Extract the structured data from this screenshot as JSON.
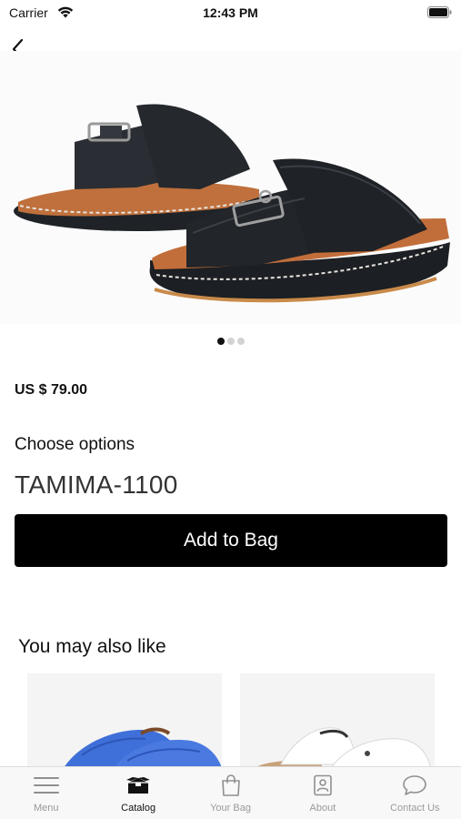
{
  "status_bar": {
    "carrier": "Carrier",
    "time": "12:43 PM"
  },
  "product": {
    "price": "US $ 79.00",
    "options_label": "Choose options",
    "option_value": "TAMIMA-1100",
    "add_button_label": "Add to Bag",
    "image_count": 3,
    "active_image": 1
  },
  "recommendations": {
    "title": "You may also like",
    "items": [
      {
        "image": "blue-sandal",
        "accent": "#3f6fd8"
      },
      {
        "image": "white-sandal",
        "accent": "#ffffff"
      }
    ]
  },
  "tab_bar": {
    "items": [
      {
        "label": "Menu",
        "icon": "menu-icon",
        "active": false
      },
      {
        "label": "Catalog",
        "icon": "catalog-box-icon",
        "active": true
      },
      {
        "label": "Your Bag",
        "icon": "shopping-bag-icon",
        "active": false
      },
      {
        "label": "About",
        "icon": "about-contact-card-icon",
        "active": false
      },
      {
        "label": "Contact Us",
        "icon": "chat-bubble-icon",
        "active": false
      }
    ]
  },
  "colors": {
    "primary_button": "#000000",
    "tab_inactive": "#9a9a9a",
    "sandal_strap": "#1f2328",
    "sandal_footbed": "#c0703c"
  }
}
